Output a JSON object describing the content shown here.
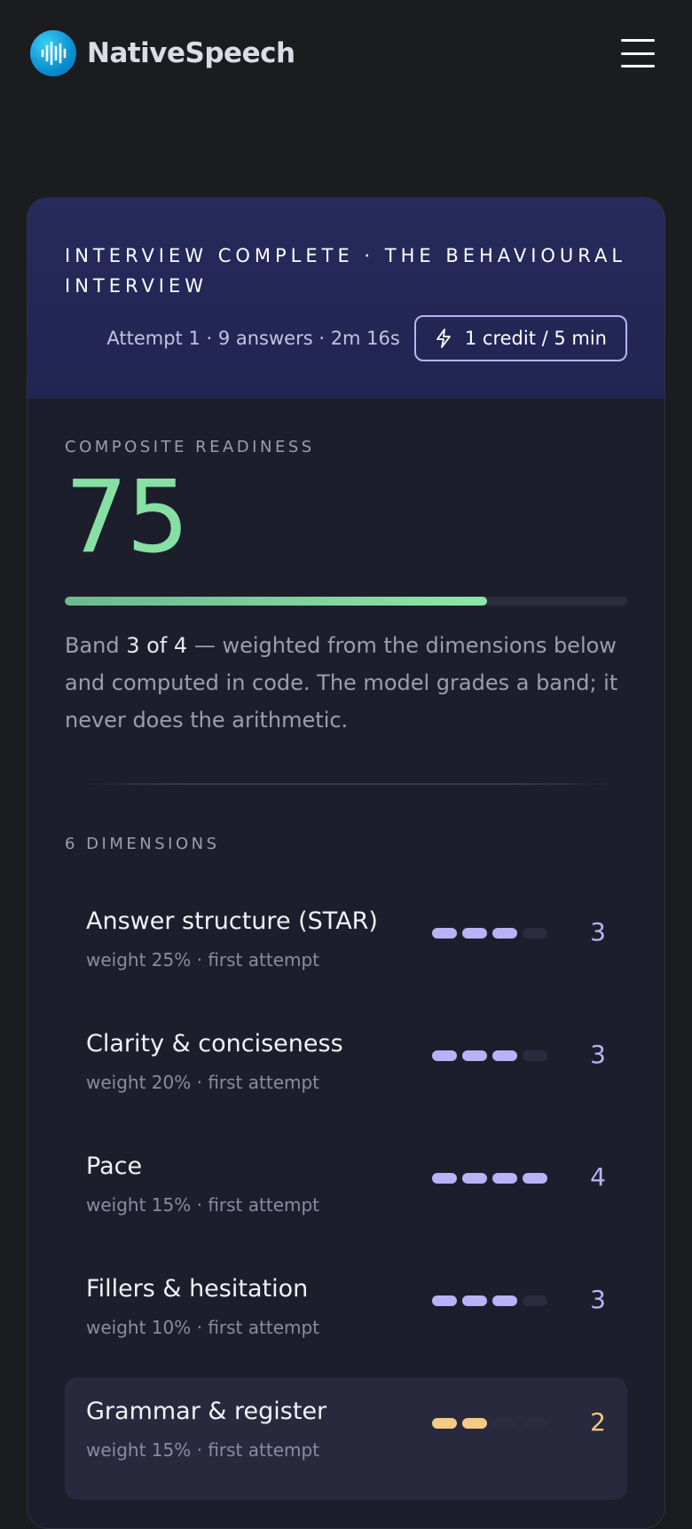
{
  "app": {
    "name": "NativeSpeech"
  },
  "header": {
    "title": "INTERVIEW COMPLETE · THE BEHAVIOURAL INTERVIEW",
    "meta": "Attempt 1 · 9 answers · 2m 16s",
    "credit": "1 credit / 5 min"
  },
  "readiness": {
    "label": "COMPOSITE READINESS",
    "score": "75",
    "progress_fraction": 0.75,
    "band_prefix": "Band ",
    "band_value": "3 of 4",
    "band_suffix": " — weighted from the dimensions below and computed in code. The model grades a band; it never does the arithmetic."
  },
  "dimensions": {
    "label": "6 DIMENSIONS",
    "max_score": 4,
    "items": [
      {
        "name": "Answer structure (STAR)",
        "sub": "weight 25% · first attempt",
        "score": 3
      },
      {
        "name": "Clarity & conciseness",
        "sub": "weight 20% · first attempt",
        "score": 3
      },
      {
        "name": "Pace",
        "sub": "weight 15% · first attempt",
        "score": 4
      },
      {
        "name": "Fillers & hesitation",
        "sub": "weight 10% · first attempt",
        "score": 3
      },
      {
        "name": "Grammar & register",
        "sub": "weight 15% · first attempt",
        "score": 2
      }
    ]
  },
  "colors": {
    "score_green": "#86e0a4",
    "pip_purple": "#b9b2f6",
    "pip_warning": "#f3cb83",
    "header_bg": "#242857",
    "page_bg": "#1b1c20"
  },
  "icons": {
    "logo": "audio-waveform-icon",
    "menu": "hamburger-menu-icon",
    "credit": "lightning-bolt-icon"
  }
}
